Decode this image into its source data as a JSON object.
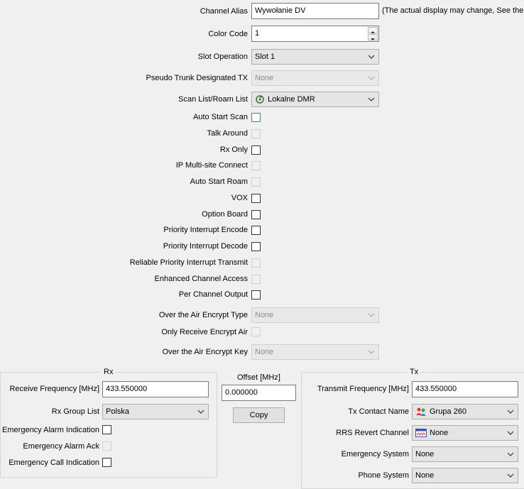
{
  "channel_alias": {
    "label": "Channel Alias",
    "value": "Wywołanie DV",
    "note": "(The actual display may change, See the h"
  },
  "color_code": {
    "label": "Color Code",
    "value": "1"
  },
  "slot_operation": {
    "label": "Slot Operation",
    "value": "Slot 1"
  },
  "pseudo_trunk": {
    "label": "Pseudo Trunk Designated TX",
    "value": "None"
  },
  "scan_list": {
    "label": "Scan List/Roam List",
    "value": "Lokalne DMR",
    "icon": "scan-list-icon"
  },
  "checkboxes": {
    "auto_start_scan": {
      "label": "Auto Start Scan",
      "checked": false,
      "enabled": true
    },
    "talk_around": {
      "label": "Talk Around",
      "checked": false,
      "enabled": false
    },
    "rx_only": {
      "label": "Rx Only",
      "checked": false,
      "enabled": true
    },
    "ip_multisite": {
      "label": "IP Multi-site Connect",
      "checked": false,
      "enabled": false
    },
    "auto_start_roam": {
      "label": "Auto Start Roam",
      "checked": false,
      "enabled": false
    },
    "vox": {
      "label": "VOX",
      "checked": false,
      "enabled": true
    },
    "option_board": {
      "label": "Option Board",
      "checked": false,
      "enabled": true
    },
    "priority_encode": {
      "label": "Priority Interrupt Encode",
      "checked": false,
      "enabled": true
    },
    "priority_decode": {
      "label": "Priority Interrupt Decode",
      "checked": false,
      "enabled": true
    },
    "reliable_priority": {
      "label": "Reliable Priority Interrupt Transmit",
      "checked": false,
      "enabled": false
    },
    "enhanced_access": {
      "label": "Enhanced Channel Access",
      "checked": false,
      "enabled": false
    },
    "per_channel_output": {
      "label": "Per Channel Output",
      "checked": false,
      "enabled": true
    }
  },
  "ota_encrypt_type": {
    "label": "Over the Air Encrypt Type",
    "value": "None"
  },
  "only_receive_encrypt": {
    "label": "Only Receive Encrypt Air",
    "checked": false,
    "enabled": false
  },
  "ota_encrypt_key": {
    "label": "Over the Air Encrypt Key",
    "value": "None"
  },
  "rx": {
    "title": "Rx",
    "freq_label": "Receive Frequency [MHz]",
    "freq_value": "433.550000",
    "group_label": "Rx Group List",
    "group_value": "Polska",
    "emergency_alarm_indication": "Emergency Alarm Indication",
    "emergency_alarm_ack": "Emergency Alarm Ack",
    "emergency_call_indication": "Emergency Call Indication"
  },
  "offset": {
    "label": "Offset [MHz]",
    "value": "0.000000",
    "copy": "Copy"
  },
  "tx": {
    "title": "Tx",
    "freq_label": "Transmit Frequency [MHz]",
    "freq_value": "433.550000",
    "contact_label": "Tx Contact Name",
    "contact_value": "Grupa 260",
    "rrs_label": "RRS Revert Channel",
    "rrs_value": "None",
    "emergency_system_label": "Emergency System",
    "emergency_system_value": "None",
    "phone_system_label": "Phone System",
    "phone_system_value": "None"
  }
}
